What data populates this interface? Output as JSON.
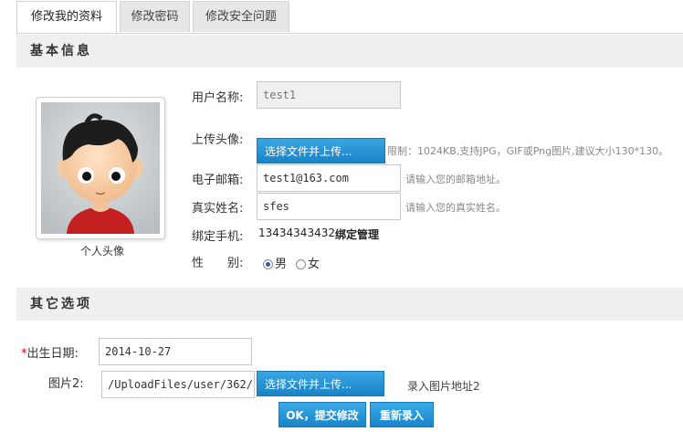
{
  "tabs": [
    {
      "label": "修改我的资料",
      "active": true
    },
    {
      "label": "修改密码",
      "active": false
    },
    {
      "label": "修改安全问题",
      "active": false
    }
  ],
  "sections": {
    "basic": "基本信息",
    "other": "其它选项"
  },
  "avatar": {
    "caption": "个人头像"
  },
  "form": {
    "username": {
      "label": "用户名称:",
      "value": "test1"
    },
    "upload_avatar": {
      "label": "上传头像:",
      "button": "选择文件并上传...",
      "hint": "限制：1024KB,支持JPG，GIF或Png图片,建议大小130*130。"
    },
    "email": {
      "label": "电子邮箱:",
      "value": "test1@163.com",
      "hint": "请输入您的邮箱地址。"
    },
    "realname": {
      "label": "真实姓名:",
      "value": "sfes",
      "hint": "请输入您的真实姓名。"
    },
    "phone": {
      "label": "绑定手机:",
      "value": "13434343432",
      "manage_link": "绑定管理"
    },
    "gender": {
      "label": "性　　别:",
      "options": [
        "男",
        "女"
      ],
      "selected": "男"
    }
  },
  "other": {
    "birthday": {
      "required_mark": "*",
      "label": "出生日期:",
      "value": "2014-10-27"
    },
    "image2": {
      "label": "图片2:",
      "value": "/UploadFiles/user/362/u",
      "button": "选择文件并上传...",
      "hint": "录入图片地址2"
    }
  },
  "actions": {
    "submit": "OK，提交修改",
    "reset": "重新录入"
  }
}
